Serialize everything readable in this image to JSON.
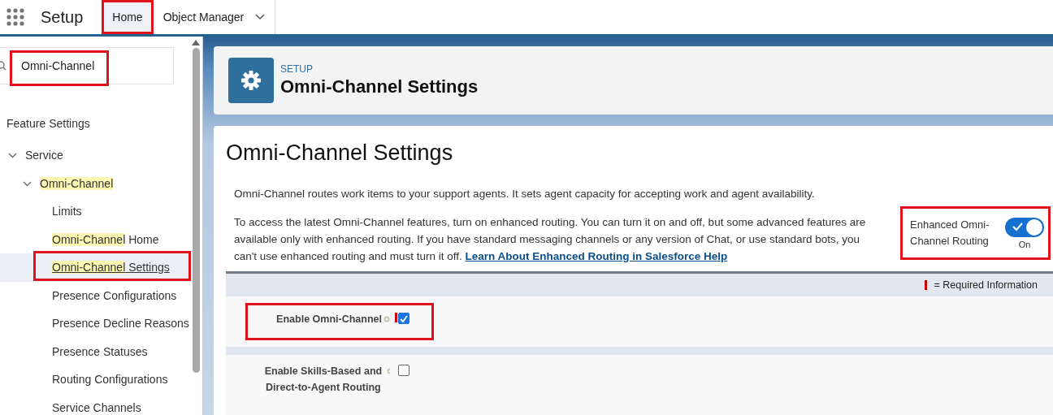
{
  "top_bar": {
    "app_name": "Setup",
    "tabs": [
      {
        "label": "Home",
        "selected": true,
        "annotated": true
      },
      {
        "label": "Object Manager",
        "selected": false,
        "dropdown": true
      }
    ]
  },
  "sidebar": {
    "search": {
      "value": "Omni-Channel",
      "annotated": true
    },
    "section_title": "Feature Settings",
    "tree": [
      {
        "label": {
          "rest": "Service"
        },
        "expanded": true,
        "selected": false,
        "children": [
          {
            "label": {
              "match": "Omni-Channel"
            },
            "expanded": true,
            "selected": false,
            "children": [
              {
                "label": {
                  "rest": "Limits"
                },
                "selected": false
              },
              {
                "label": {
                  "match": "Omni-Channel",
                  "rest": " Home"
                },
                "selected": false
              },
              {
                "label": {
                  "match": "Omni-Channel",
                  "rest": " Settings"
                },
                "selected": true,
                "annotated": true
              },
              {
                "label": {
                  "rest": "Presence Configurations"
                },
                "selected": false
              },
              {
                "label": {
                  "rest": "Presence Decline Reasons"
                },
                "selected": false
              },
              {
                "label": {
                  "rest": "Presence Statuses"
                },
                "selected": false
              },
              {
                "label": {
                  "rest": "Routing Configurations"
                },
                "selected": false
              },
              {
                "label": {
                  "rest": "Service Channels"
                },
                "selected": false
              }
            ]
          }
        ]
      }
    ]
  },
  "header": {
    "eyebrow": "SETUP",
    "title": "Omni-Channel Settings"
  },
  "content": {
    "title": "Omni-Channel Settings",
    "intro": "Omni-Channel routes work items to your support agents. It sets agent capacity for accepting work and agent availability.",
    "routing_text": "To access the latest Omni-Channel features, turn on enhanced routing. You can turn it on and off, but some advanced features are available only with enhanced routing. If you have standard messaging channels or any version of Chat, or use standard bots, you can't use enhanced routing and must turn it off.",
    "routing_link": "Learn About Enhanced Routing in Salesforce Help",
    "toggle": {
      "label": "Enhanced Omni-Channel Routing",
      "on": true,
      "state_text": "On",
      "annotated": true
    },
    "required_legend": "= Required Information",
    "fields": [
      {
        "label": "Enable Omni-Channel",
        "required": true,
        "checked": true,
        "annotated": true
      },
      {
        "label": "Enable Skills-Based and Direct-to-Agent Routing",
        "checked": false
      }
    ]
  }
}
